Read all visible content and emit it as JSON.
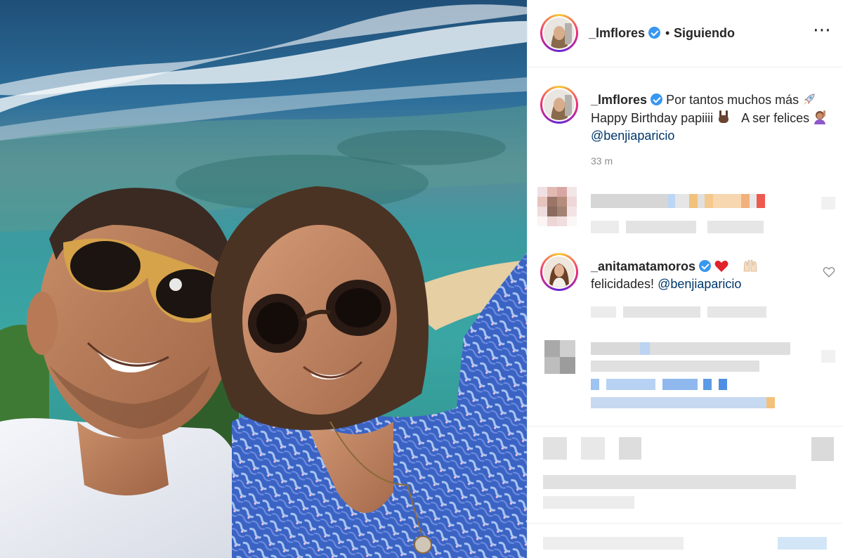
{
  "post": {
    "author": "_lmflores",
    "follow_status": "Siguiendo",
    "separator": "•",
    "more_icon": "⋯",
    "caption_line1": "Por tantos muchos más",
    "caption_line2": "Happy Birthday papiiii",
    "caption_line2b": "A ser felices",
    "caption_mention": "@benjiaparicio",
    "time": "33 m"
  },
  "comments": [
    {
      "author": "_anitamatamoros",
      "text": "felicidades!",
      "mention": "@benjiaparicio"
    }
  ],
  "colors": {
    "verified": "#3897f0",
    "mention": "#00376b",
    "muted": "#8e8e8e",
    "heart": "#ed4956"
  },
  "icons": [
    "verified-badge-icon",
    "more-options-icon",
    "rocket-emoji-icon",
    "rock-hand-emoji-icon",
    "woman-raising-hand-emoji-icon",
    "red-heart-emoji-icon",
    "raised-hands-emoji-icon",
    "like-heart-icon"
  ]
}
